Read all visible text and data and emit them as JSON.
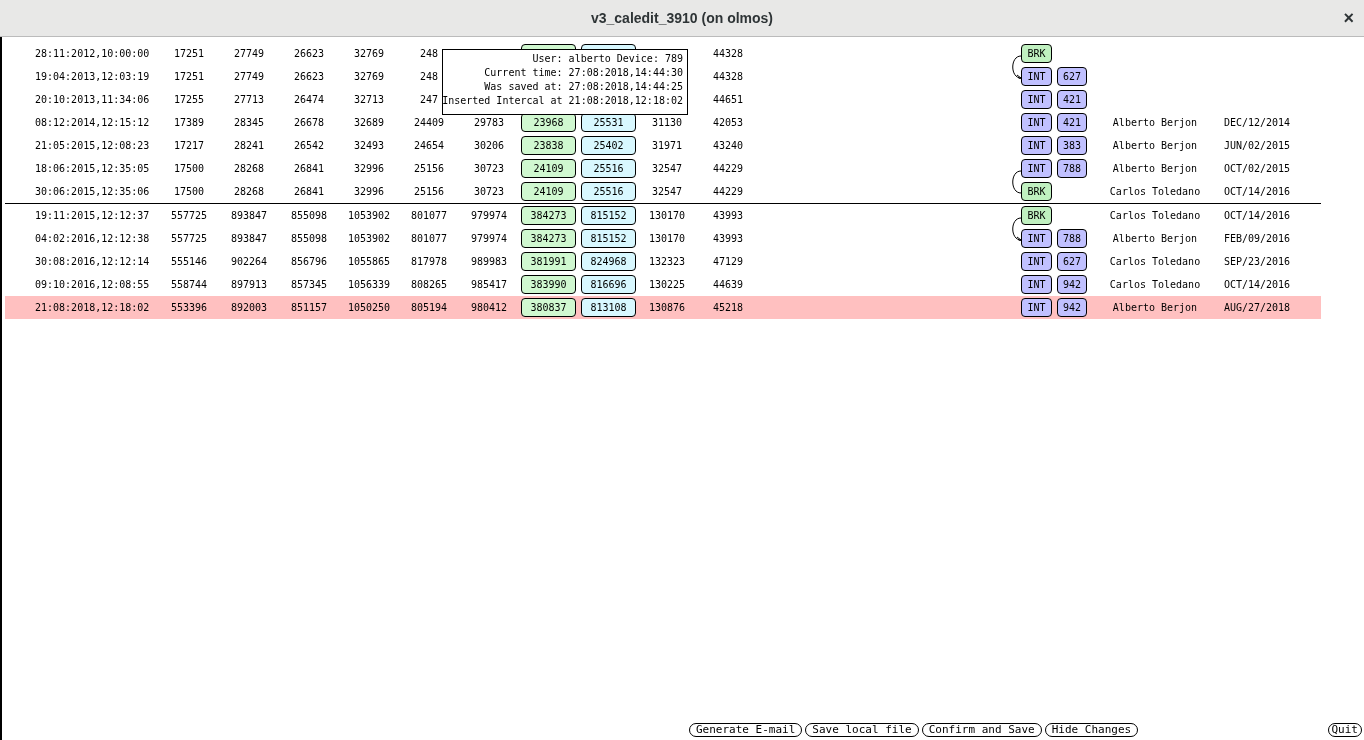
{
  "window": {
    "title": "v3_caledit_3910 (on olmos)",
    "close": "×"
  },
  "sections": [
    {
      "rows": [
        {
          "selected": false,
          "cells": [
            "28:11:2012,10:00:00",
            "17251",
            "27749",
            "26623",
            "32769",
            "248",
            null,
            null,
            null,
            null,
            "44328"
          ],
          "tag": {
            "kind": "brk",
            "label": "BRK"
          },
          "link": {
            "kind": "arrow"
          }
        },
        {
          "selected": false,
          "cells": [
            "19:04:2013,12:03:19",
            "17251",
            "27749",
            "26623",
            "32769",
            "248",
            null,
            null,
            null,
            null,
            "44328"
          ],
          "tag": {
            "kind": "int",
            "label": "INT"
          },
          "code": "627"
        },
        {
          "selected": false,
          "cells": [
            "20:10:2013,11:34:06",
            "17255",
            "27713",
            "26474",
            "32713",
            "247",
            null,
            null,
            null,
            null,
            "44651"
          ],
          "tag": {
            "kind": "int",
            "label": "INT"
          },
          "code": "421"
        },
        {
          "selected": false,
          "cells": [
            "08:12:2014,12:15:12",
            "17389",
            "28345",
            "26678",
            "32689",
            "24409",
            "29783",
            "23968",
            "25531",
            "31130",
            "42053"
          ],
          "tag": {
            "kind": "int",
            "label": "INT"
          },
          "code": "421",
          "user": "Alberto Berjon",
          "date": "DEC/12/2014"
        },
        {
          "selected": false,
          "cells": [
            "21:05:2015,12:08:23",
            "17217",
            "28241",
            "26542",
            "32493",
            "24654",
            "30206",
            "23838",
            "25402",
            "31971",
            "43240"
          ],
          "tag": {
            "kind": "int",
            "label": "INT"
          },
          "code": "383",
          "user": "Alberto Berjon",
          "date": "JUN/02/2015"
        },
        {
          "selected": false,
          "cells": [
            "18:06:2015,12:35:05",
            "17500",
            "28268",
            "26841",
            "32996",
            "25156",
            "30723",
            "24109",
            "25516",
            "32547",
            "44229"
          ],
          "tag": {
            "kind": "int",
            "label": "INT"
          },
          "code": "788",
          "user": "Alberto Berjon",
          "date": "OCT/02/2015",
          "link": {
            "kind": "plain"
          }
        },
        {
          "selected": false,
          "cells": [
            "30:06:2015,12:35:06",
            "17500",
            "28268",
            "26841",
            "32996",
            "25156",
            "30723",
            "24109",
            "25516",
            "32547",
            "44229"
          ],
          "tag": {
            "kind": "brk",
            "label": "BRK"
          },
          "user": "Carlos Toledano",
          "date": "OCT/14/2016"
        }
      ]
    },
    {
      "rows": [
        {
          "selected": false,
          "cells": [
            "19:11:2015,12:12:37",
            "557725",
            "893847",
            "855098",
            "1053902",
            "801077",
            "979974",
            "384273",
            "815152",
            "130170",
            "43993"
          ],
          "tag": {
            "kind": "brk",
            "label": "BRK"
          },
          "user": "Carlos Toledano",
          "date": "OCT/14/2016",
          "link": {
            "kind": "arrow"
          }
        },
        {
          "selected": false,
          "cells": [
            "04:02:2016,12:12:38",
            "557725",
            "893847",
            "855098",
            "1053902",
            "801077",
            "979974",
            "384273",
            "815152",
            "130170",
            "43993"
          ],
          "tag": {
            "kind": "int",
            "label": "INT"
          },
          "code": "788",
          "user": "Alberto Berjon",
          "date": "FEB/09/2016"
        },
        {
          "selected": false,
          "cells": [
            "30:08:2016,12:12:14",
            "555146",
            "902264",
            "856796",
            "1055865",
            "817978",
            "989983",
            "381991",
            "824968",
            "132323",
            "47129"
          ],
          "tag": {
            "kind": "int",
            "label": "INT"
          },
          "code": "627",
          "user": "Carlos Toledano",
          "date": "SEP/23/2016"
        },
        {
          "selected": false,
          "cells": [
            "09:10:2016,12:08:55",
            "558744",
            "897913",
            "857345",
            "1056339",
            "808265",
            "985417",
            "383990",
            "816696",
            "130225",
            "44639"
          ],
          "tag": {
            "kind": "int",
            "label": "INT"
          },
          "code": "942",
          "user": "Carlos Toledano",
          "date": "OCT/14/2016"
        },
        {
          "selected": true,
          "cells": [
            "21:08:2018,12:18:02",
            "553396",
            "892003",
            "851157",
            "1050250",
            "805194",
            "980412",
            "380837",
            "813108",
            "130876",
            "45218"
          ],
          "tag": {
            "kind": "int",
            "label": "INT"
          },
          "code": "942",
          "user": "Alberto Berjon",
          "date": "AUG/27/2018"
        }
      ]
    }
  ],
  "tooltip": [
    "User: alberto Device: 789",
    "Current time: 27:08:2018,14:44:30",
    "Was saved at: 27:08:2018,14:44:25",
    "Inserted Intercal at 21:08:2018,12:18:02"
  ],
  "buttons": [
    "Generate E-mail",
    "Save local file",
    "Confirm and Save",
    "Hide Changes"
  ],
  "quit": "Quit"
}
